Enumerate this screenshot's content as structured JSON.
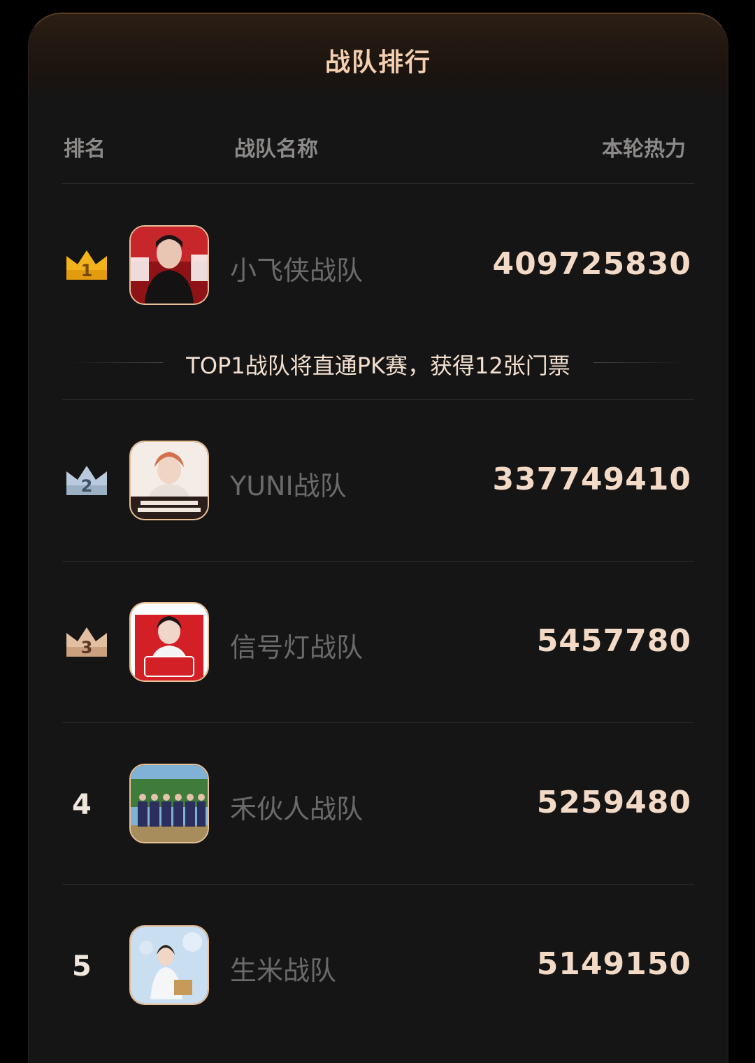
{
  "panel": {
    "title": "战队排行"
  },
  "columns": {
    "rank": "排名",
    "name": "战队名称",
    "heat": "本轮热力"
  },
  "notice": "TOP1战队将直通PK赛，获得12张门票",
  "teams": [
    {
      "rank": "1",
      "name": "小飞侠战队",
      "heat": "409725830",
      "crown_color": "#f2b21c"
    },
    {
      "rank": "2",
      "name": "YUNI战队",
      "heat": "337749410",
      "crown_color": "#a9bfd4"
    },
    {
      "rank": "3",
      "name": "信号灯战队",
      "heat": "5457780",
      "crown_color": "#d8b394"
    },
    {
      "rank": "4",
      "name": "禾伙人战队",
      "heat": "5259480"
    },
    {
      "rank": "5",
      "name": "生米战队",
      "heat": "5149150"
    }
  ],
  "colors": {
    "accent": "#f3cfb0",
    "avatar_border": "#e9bf97",
    "background": "#151516"
  }
}
